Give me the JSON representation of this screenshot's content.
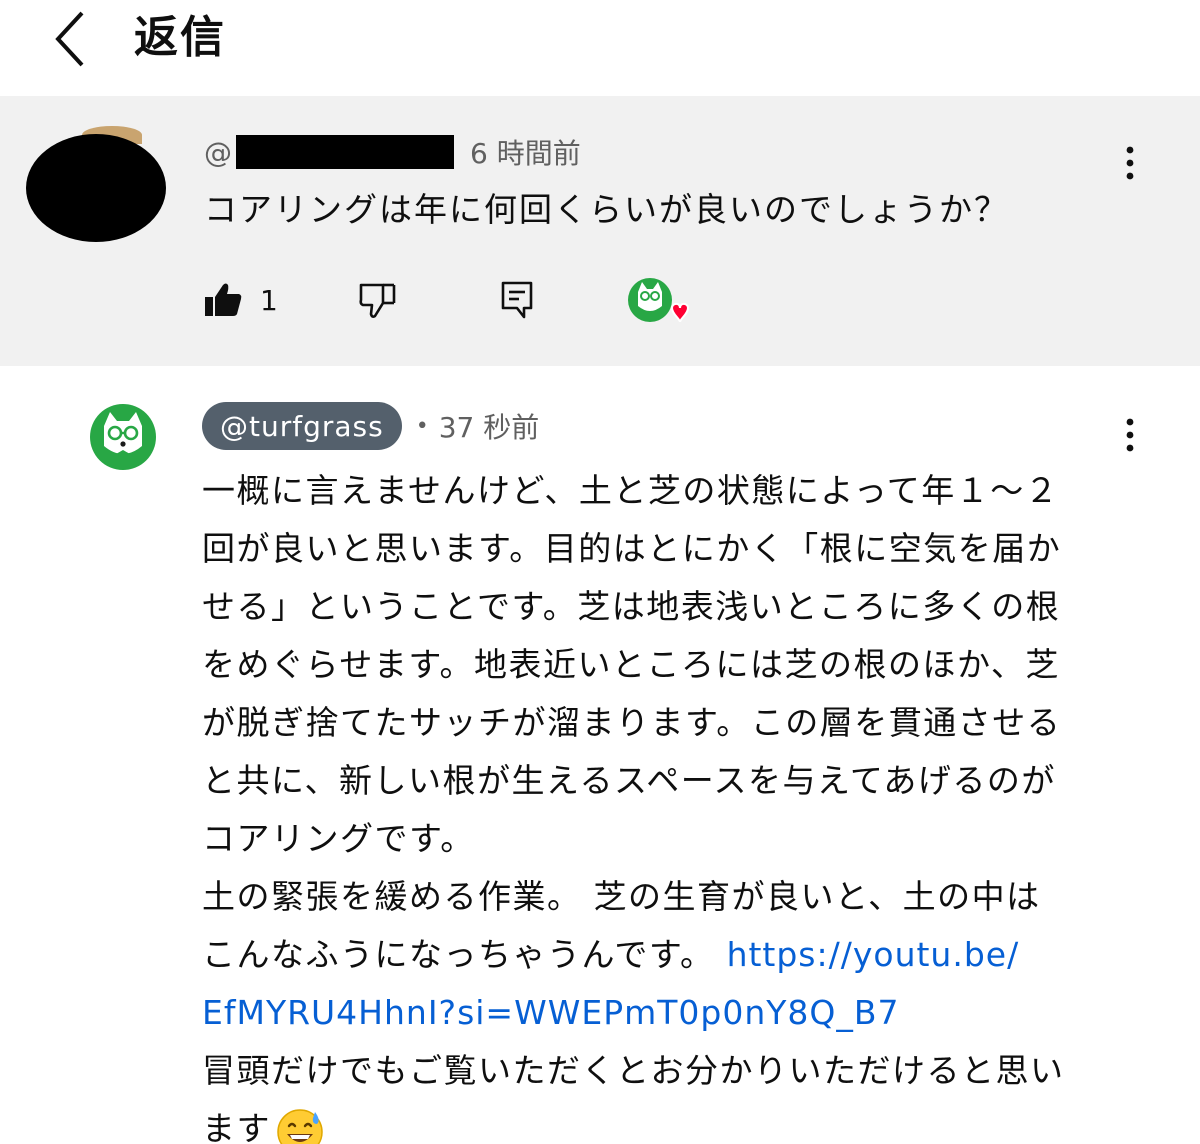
{
  "header": {
    "title": "返信"
  },
  "parent": {
    "at": "@",
    "time": "6 時間前",
    "text": "コアリングは年に何回くらいが良いのでしょうか？",
    "like_count": "1"
  },
  "reply": {
    "handle": "@turfgrass",
    "time": "37 秒前",
    "lines": [
      "一概に言えませんけど、土と芝の状態によって年１～２",
      "回が良いと思います。目的はとにかく「根に空気を届か",
      "せる」ということです。芝は地表浅いところに多くの根",
      "をめぐらせます。地表近いところには芝の根のほか、芝",
      "が脱ぎ捨てたサッチが溜まります。この層を貫通させる",
      "と共に、新しい根が生えるスペースを与えてあげるのが",
      "コアリングです。",
      "土の緊張を緩める作業。 芝の生育が良いと、土の中は"
    ],
    "line9_text": "こんなふうになっちゃうんです。",
    "link_part1": "https://youtu.be/",
    "link_part2": "EfMYRU4HhnI?si=WWEPmT0p0nY8Q_B7",
    "line11": "冒頭だけでもご覧いただくとお分かりいただけると思い",
    "line12": "ます"
  },
  "colors": {
    "parent_bg": "#f1f1f1",
    "chip": "#54606c",
    "link": "#065fd4",
    "brand_green": "#28a745",
    "heart": "#ff0033"
  },
  "icons": [
    "back-chevron-icon",
    "more-vert-icon",
    "thumb-up-icon",
    "thumb-down-icon",
    "reply-comment-icon",
    "creator-heart-icon",
    "sweat-smile-emoji-icon"
  ]
}
